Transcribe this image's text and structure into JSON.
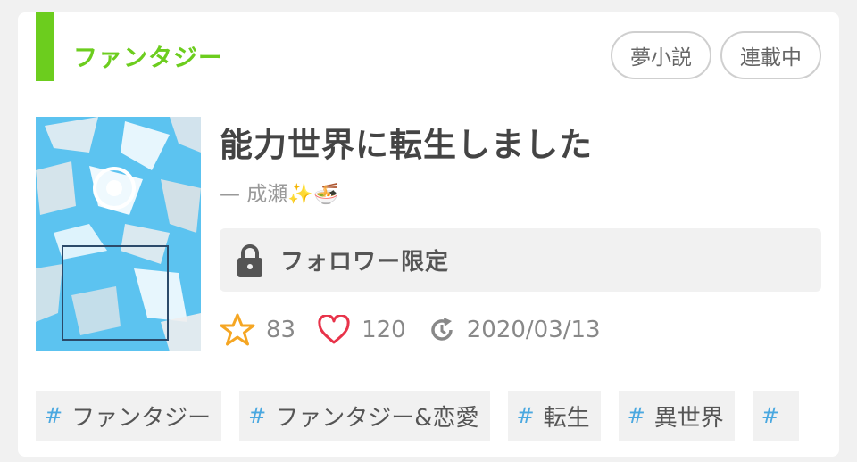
{
  "genre": {
    "label": "ファンタジー",
    "color": "#6ccd1e"
  },
  "badges": [
    {
      "label": "夢小説"
    },
    {
      "label": "連載中"
    }
  ],
  "cover": {
    "alt": "cover"
  },
  "novel": {
    "title": "能力世界に転生しました",
    "author": "— 成瀬✨🍜"
  },
  "access": {
    "icon": "lock-icon",
    "label": "フォロワー限定"
  },
  "stats": {
    "stars": "83",
    "hearts": "120",
    "updated": "2020/03/13",
    "star_color": "#f5a623",
    "heart_color": "#e8334a",
    "update_icon": "refresh-icon"
  },
  "tags": [
    {
      "hash": "#",
      "label": "ファンタジー"
    },
    {
      "hash": "#",
      "label": "ファンタジー&恋愛"
    },
    {
      "hash": "#",
      "label": "転生"
    },
    {
      "hash": "#",
      "label": "異世界"
    },
    {
      "hash": "#",
      "label": ""
    }
  ]
}
